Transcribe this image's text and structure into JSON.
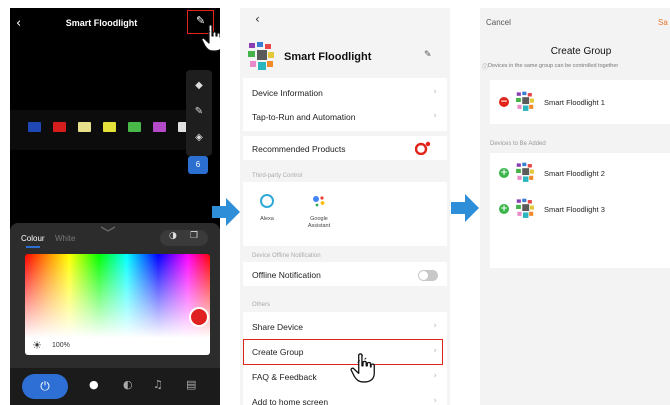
{
  "panel1": {
    "back_glyph": "‹",
    "title": "Smart Floodlight",
    "edit_glyph": "✎",
    "tools": [
      "◆",
      "✎",
      "◈"
    ],
    "badge": "6",
    "chip_colors": [
      "#1f48b5",
      "#d61d1d",
      "#e6e08a",
      "#e4e23a",
      "#48b848",
      "#b54ac8",
      "#e0e0e0"
    ],
    "segments": {
      "colour": "Colour",
      "white": "White"
    },
    "brightness_icon": "☀",
    "brightness": "100%",
    "tabbar": {
      "power_glyph": "⏻",
      "bulb_glyph": "●",
      "palette_glyph": "◐",
      "music_glyph": "♫",
      "timer_glyph": "▤"
    }
  },
  "panel2": {
    "back_glyph": "‹",
    "device_name": "Smart Floodlight",
    "edit_glyph": "✎",
    "chevron": "›",
    "rows_top": [
      "Device Information",
      "Tap-to-Run and Automation"
    ],
    "recommended": "Recommended Products",
    "section_third_party": "Third-party Control",
    "assistants": [
      {
        "name": "Alexa"
      },
      {
        "name": "Google\nAssistant"
      }
    ],
    "section_offline": "Device Offline Notification",
    "offline_label": "Offline Notification",
    "section_others": "Others",
    "rows_others": [
      "Share Device",
      "Create Group",
      "FAQ & Feedback",
      "Add to home screen"
    ]
  },
  "panel3": {
    "cancel": "Cancel",
    "save": "Sa",
    "title": "Create Group",
    "info_glyph": "ⓘ",
    "subtitle": "Devices in the same group can be controlled together",
    "group_devices": [
      "Smart Floodlight 1"
    ],
    "section_to_add": "Devices to Be Added",
    "to_add": [
      "Smart Floodlight 2",
      "Smart Floodlight 3"
    ],
    "minus_glyph": "−",
    "plus_glyph": "+"
  },
  "colors": {
    "accent_red": "#e2231a",
    "accent_blue": "#2e6fd5",
    "arrow_blue": "#2f8ed8",
    "add_green": "#3bb54a"
  }
}
